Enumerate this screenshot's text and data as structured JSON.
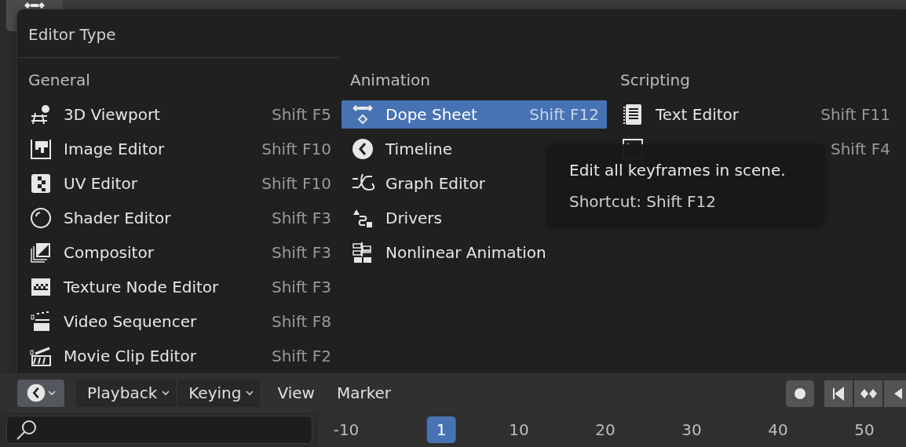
{
  "menu": {
    "title": "Editor Type",
    "columns": [
      {
        "heading": "General",
        "items": [
          {
            "kind": "viewport",
            "label": "3D Viewport",
            "shortcut": "Shift F5",
            "selected": false
          },
          {
            "kind": "image",
            "label": "Image Editor",
            "shortcut": "Shift F10",
            "selected": false
          },
          {
            "kind": "uv",
            "label": "UV Editor",
            "shortcut": "Shift F10",
            "selected": false
          },
          {
            "kind": "shader",
            "label": "Shader Editor",
            "shortcut": "Shift F3",
            "selected": false
          },
          {
            "kind": "compositor",
            "label": "Compositor",
            "shortcut": "Shift F3",
            "selected": false
          },
          {
            "kind": "texture",
            "label": "Texture Node Editor",
            "shortcut": "Shift F3",
            "selected": false
          },
          {
            "kind": "sequencer",
            "label": "Video Sequencer",
            "shortcut": "Shift F8",
            "selected": false
          },
          {
            "kind": "clip",
            "label": "Movie Clip Editor",
            "shortcut": "Shift F2",
            "selected": false
          }
        ]
      },
      {
        "heading": "Animation",
        "items": [
          {
            "kind": "dopesheet",
            "label": "Dope Sheet",
            "shortcut": "Shift F12",
            "selected": true
          },
          {
            "kind": "timeline",
            "label": "Timeline",
            "selected": false
          },
          {
            "kind": "graph",
            "label": "Graph Editor",
            "selected": false
          },
          {
            "kind": "drivers",
            "label": "Drivers",
            "selected": false
          },
          {
            "kind": "nla",
            "label": "Nonlinear Animation",
            "selected": false
          }
        ]
      },
      {
        "heading": "Scripting",
        "items": [
          {
            "kind": "text",
            "label": "Text Editor",
            "shortcut": "Shift F11",
            "selected": false
          },
          {
            "kind": "console",
            "shortcut": "Shift F4",
            "selected": false
          }
        ]
      }
    ]
  },
  "tooltip": {
    "description": "Edit all keyframes in scene.",
    "shortcut": "Shortcut: Shift F12"
  },
  "timeline_header": {
    "menus": [
      {
        "label": "Playback",
        "dropdown": true
      },
      {
        "label": "Keying",
        "dropdown": true
      },
      {
        "label": "View",
        "dropdown": false
      },
      {
        "label": "Marker",
        "dropdown": false
      }
    ]
  },
  "timeline": {
    "frames": [
      {
        "label": "-10",
        "selected": false
      },
      {
        "label": "1",
        "selected": true
      },
      {
        "label": "10",
        "selected": false
      },
      {
        "label": "20",
        "selected": false
      },
      {
        "label": "30",
        "selected": false
      },
      {
        "label": "40",
        "selected": false
      },
      {
        "label": "50",
        "selected": false
      }
    ]
  }
}
